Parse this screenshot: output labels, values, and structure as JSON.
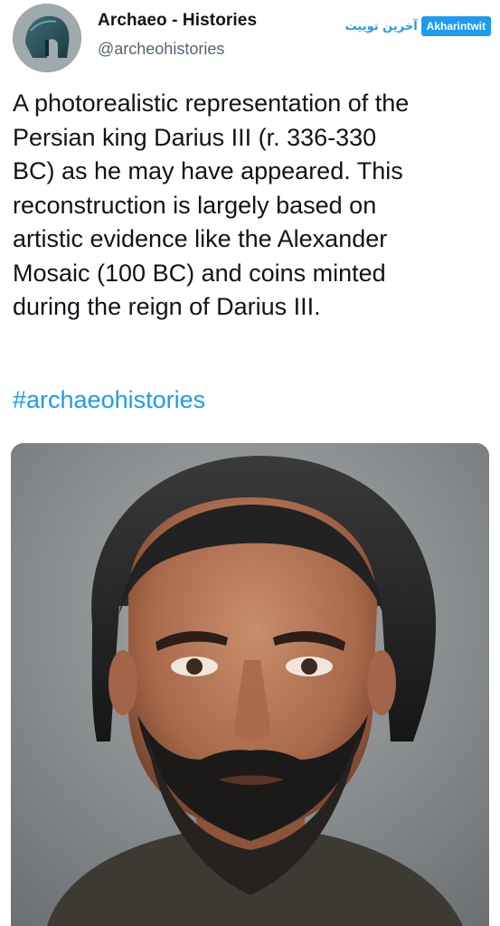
{
  "author": {
    "display_name": "Archaeo - Histories",
    "handle": "@archeohistories",
    "avatar_icon": "bronze-helmet-avatar"
  },
  "watermark": {
    "persian_text": "آخرین توییت",
    "latin_text": "Akharintwit",
    "color": "#1d9bf0"
  },
  "tweet": {
    "lines": [
      "A photorealistic representation of the",
      "Persian king Darius III (r. 336-330",
      "BC) as he may have appeared. This",
      "reconstruction is largely based on",
      "artistic evidence like the Alexander",
      "Mosaic (100 BC) and coins minted",
      "during the reign of Darius III."
    ],
    "hashtag": "#archaeohistories"
  },
  "media": {
    "type": "photo",
    "subject_icon": "bearded-man-portrait"
  },
  "colors": {
    "text": "#0f1419",
    "secondary": "#536471",
    "link": "#1d9bf0"
  }
}
